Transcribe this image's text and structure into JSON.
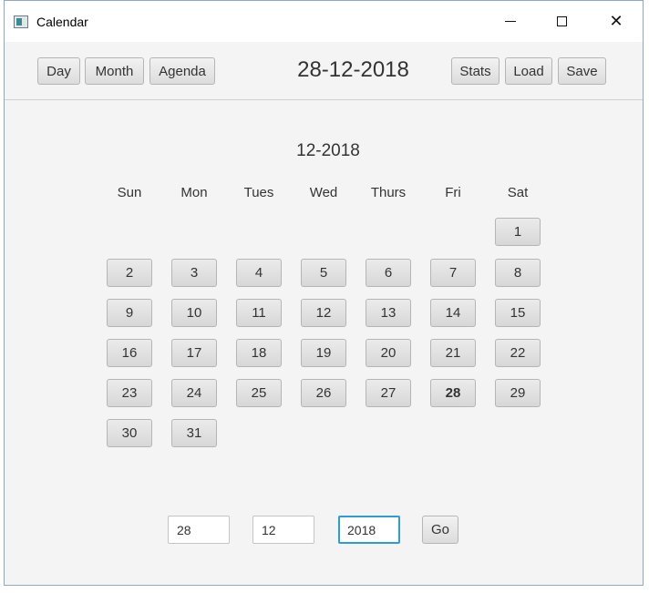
{
  "window": {
    "title": "Calendar",
    "icon": "app-window-icon"
  },
  "toolbar": {
    "left_buttons": [
      "Day",
      "Month",
      "Agenda"
    ],
    "current_date": "28-12-2018",
    "right_buttons": [
      "Stats",
      "Load",
      "Save"
    ]
  },
  "calendar": {
    "month_label": "12-2018",
    "weekdays": [
      "Sun",
      "Mon",
      "Tues",
      "Wed",
      "Thurs",
      "Fri",
      "Sat"
    ],
    "days": [
      "1",
      "2",
      "3",
      "4",
      "5",
      "6",
      "7",
      "8",
      "9",
      "10",
      "11",
      "12",
      "13",
      "14",
      "15",
      "16",
      "17",
      "18",
      "19",
      "20",
      "21",
      "22",
      "23",
      "24",
      "25",
      "26",
      "27",
      "28",
      "29",
      "30",
      "31"
    ],
    "first_weekday_index": 6,
    "selected_day": "28"
  },
  "goto": {
    "day_value": "28",
    "month_value": "12",
    "year_value": "2018",
    "go_label": "Go"
  },
  "colors": {
    "focus_border": "#2d9cdb",
    "window_border": "#8fa9c4"
  }
}
